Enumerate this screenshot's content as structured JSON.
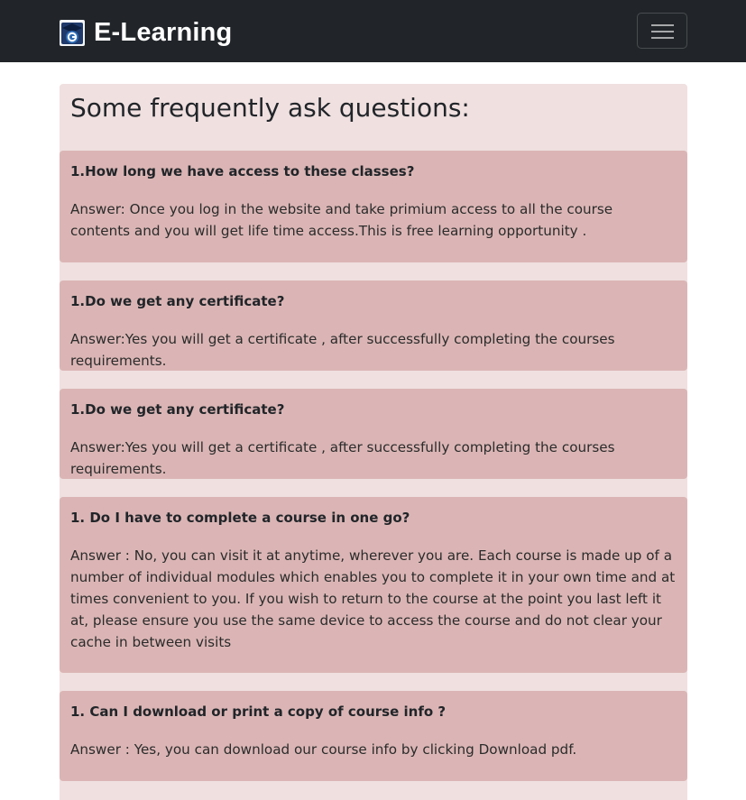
{
  "navbar": {
    "brand": "E-Learning",
    "brand_logo_icon": "graduation-cap-logo-icon",
    "toggler_icon": "hamburger-menu-icon",
    "background": "#212529"
  },
  "faq": {
    "heading": "Some frequently ask questions:",
    "container_color": "#f0e0e0",
    "card_color": "#dbb5b5",
    "items": [
      {
        "question": "1.How long we have access to these classes?",
        "answer": "Answer: Once you log in the website and take primium access to all the course contents and you will get life time access.This is free learning opportunity ."
      },
      {
        "question": "1.Do we get any certificate?",
        "answer": "Answer:Yes you will get a certificate , after successfully completing the courses requirements."
      },
      {
        "question": "1.Do we get any certificate?",
        "answer": "Answer:Yes you will get a certificate , after successfully completing the courses requirements."
      },
      {
        "question": "1. Do I have to complete a course in one go?",
        "answer": "Answer : No, you can visit it at anytime, wherever you are. Each course is made up of a number of individual modules which enables you to complete it in your own time and at times convenient to you. If you wish to return to the course at the point you last left it at, please ensure you use the same device to access the course and do not clear your cache in between visits"
      },
      {
        "question": "1. Can I download or print a copy of course info ?",
        "answer": "Answer : Yes, you can download our course info by clicking Download pdf."
      }
    ]
  }
}
